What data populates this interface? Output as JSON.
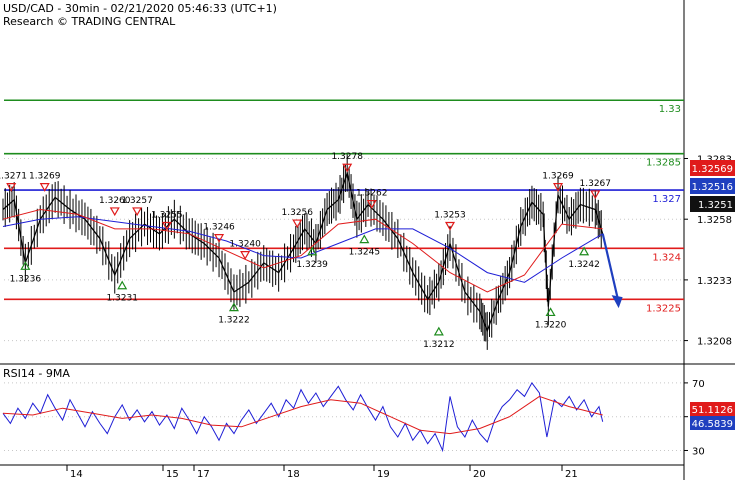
{
  "header": {
    "line1": "USD/CAD - 30min - 02/21/2020 05:46:33 (UTC+1)",
    "line2": "Research © TRADING CENTRAL"
  },
  "rsi_title": "RSI14 - 9MA",
  "chart_data": [
    {
      "type": "candlestick",
      "ylim": [
        1.32,
        1.3345
      ],
      "y_ticks": [
        "1.3283",
        "1.3258",
        "1.3233",
        "1.3208"
      ],
      "x_ticks": [
        "14",
        "15",
        "17",
        "18",
        "19",
        "20",
        "21"
      ],
      "levels": [
        {
          "label": "1.33",
          "value": 1.3307,
          "color": "#1e8c1e"
        },
        {
          "label": "1.3285",
          "value": 1.3285,
          "color": "#1e8c1e"
        },
        {
          "label": "1.327",
          "value": 1.327,
          "color": "#1f1fd6"
        },
        {
          "label": "1.324",
          "value": 1.3246,
          "color": "#e01b1b"
        },
        {
          "label": "1.3225",
          "value": 1.3225,
          "color": "#e01b1b"
        }
      ],
      "price_tags": [
        {
          "label": "1.32569",
          "value": 1.3257,
          "color": "#e01b1b"
        },
        {
          "label": "1.32516",
          "value": 1.3251,
          "color": "#1f3fbf"
        },
        {
          "label": "1.3251",
          "value": 1.3244,
          "color": "#111111"
        }
      ],
      "highs": [
        {
          "label": "1.3271",
          "x": 0.11,
          "value": 1.3271
        },
        {
          "label": "1.3269",
          "x": 0.56,
          "value": 1.3271
        },
        {
          "label": "1.3260",
          "x": 1.5,
          "value": 1.3261
        },
        {
          "label": "1.3257",
          "x": 1.8,
          "value": 1.3261
        },
        {
          "label": "1.3255",
          "x": 2.2,
          "value": 1.3255
        },
        {
          "label": "1.3246",
          "x": 2.9,
          "value": 1.325
        },
        {
          "label": "1.3240",
          "x": 3.25,
          "value": 1.3243
        },
        {
          "label": "1.3256",
          "x": 3.95,
          "value": 1.3256
        },
        {
          "label": "1.3278",
          "x": 4.62,
          "value": 1.3279
        },
        {
          "label": "1.3262",
          "x": 4.95,
          "value": 1.3264
        },
        {
          "label": "1.3253",
          "x": 6.0,
          "value": 1.3255
        },
        {
          "label": "1.3269",
          "x": 7.45,
          "value": 1.3271
        },
        {
          "label": "1.3267",
          "x": 7.95,
          "value": 1.3268
        }
      ],
      "lows": [
        {
          "label": "1.3236",
          "x": 0.3,
          "value": 1.3239
        },
        {
          "label": "1.3231",
          "x": 1.6,
          "value": 1.3231
        },
        {
          "label": "1.3222",
          "x": 3.1,
          "value": 1.3222
        },
        {
          "label": "1.3239",
          "x": 4.15,
          "value": 1.3245
        },
        {
          "label": "1.3245",
          "x": 4.85,
          "value": 1.325
        },
        {
          "label": "1.3212",
          "x": 5.85,
          "value": 1.3212
        },
        {
          "label": "1.3242",
          "x": 7.8,
          "value": 1.3245
        },
        {
          "label": "1.3220",
          "x": 7.35,
          "value": 1.322
        }
      ],
      "price_path": [
        [
          0,
          1.3262
        ],
        [
          0.15,
          1.3266
        ],
        [
          0.3,
          1.324
        ],
        [
          0.5,
          1.3258
        ],
        [
          0.7,
          1.3267
        ],
        [
          0.9,
          1.3262
        ],
        [
          1.1,
          1.3258
        ],
        [
          1.3,
          1.325
        ],
        [
          1.5,
          1.3235
        ],
        [
          1.7,
          1.325
        ],
        [
          1.9,
          1.3256
        ],
        [
          2.1,
          1.3252
        ],
        [
          2.3,
          1.3258
        ],
        [
          2.5,
          1.3252
        ],
        [
          2.7,
          1.3248
        ],
        [
          2.9,
          1.3242
        ],
        [
          3.1,
          1.3228
        ],
        [
          3.3,
          1.3232
        ],
        [
          3.5,
          1.324
        ],
        [
          3.7,
          1.3236
        ],
        [
          3.9,
          1.3246
        ],
        [
          4.05,
          1.3254
        ],
        [
          4.2,
          1.3248
        ],
        [
          4.35,
          1.3262
        ],
        [
          4.5,
          1.3266
        ],
        [
          4.62,
          1.3277
        ],
        [
          4.75,
          1.3258
        ],
        [
          4.9,
          1.3264
        ],
        [
          5.1,
          1.3258
        ],
        [
          5.3,
          1.325
        ],
        [
          5.5,
          1.3236
        ],
        [
          5.7,
          1.3225
        ],
        [
          5.85,
          1.3232
        ],
        [
          6.0,
          1.3248
        ],
        [
          6.2,
          1.3228
        ],
        [
          6.4,
          1.322
        ],
        [
          6.5,
          1.3212
        ],
        [
          6.65,
          1.3225
        ],
        [
          6.8,
          1.3236
        ],
        [
          6.95,
          1.3255
        ],
        [
          7.1,
          1.3265
        ],
        [
          7.25,
          1.326
        ],
        [
          7.32,
          1.3222
        ],
        [
          7.45,
          1.3268
        ],
        [
          7.6,
          1.3258
        ],
        [
          7.75,
          1.3264
        ],
        [
          7.95,
          1.3262
        ],
        [
          8.05,
          1.3252
        ]
      ],
      "ma_red": [
        [
          0,
          1.3258
        ],
        [
          0.5,
          1.3262
        ],
        [
          1.0,
          1.326
        ],
        [
          1.5,
          1.3254
        ],
        [
          2.0,
          1.3254
        ],
        [
          2.5,
          1.3252
        ],
        [
          3.0,
          1.3245
        ],
        [
          3.5,
          1.3238
        ],
        [
          4.0,
          1.3243
        ],
        [
          4.5,
          1.3256
        ],
        [
          5.0,
          1.3258
        ],
        [
          5.5,
          1.3248
        ],
        [
          6.0,
          1.3236
        ],
        [
          6.5,
          1.3228
        ],
        [
          7.0,
          1.3235
        ],
        [
          7.5,
          1.3256
        ],
        [
          8.05,
          1.3254
        ]
      ],
      "ma_blue": [
        [
          0,
          1.3255
        ],
        [
          0.5,
          1.3258
        ],
        [
          1.0,
          1.3259
        ],
        [
          1.5,
          1.3257
        ],
        [
          2.0,
          1.3255
        ],
        [
          2.5,
          1.3253
        ],
        [
          3.0,
          1.3249
        ],
        [
          3.5,
          1.3243
        ],
        [
          4.0,
          1.3242
        ],
        [
          4.5,
          1.3248
        ],
        [
          5.0,
          1.3254
        ],
        [
          5.5,
          1.3254
        ],
        [
          6.0,
          1.3246
        ],
        [
          6.5,
          1.3236
        ],
        [
          7.0,
          1.3232
        ],
        [
          7.5,
          1.3242
        ],
        [
          8.05,
          1.3252
        ]
      ],
      "forecast_arrow": [
        [
          8.05,
          1.3252
        ],
        [
          8.25,
          1.3223
        ]
      ]
    },
    {
      "type": "line",
      "title": "RSI14 - 9MA",
      "ylim": [
        22,
        80
      ],
      "y_ticks": [
        "70",
        "50",
        "30"
      ],
      "tags": [
        {
          "label": "51.1126",
          "value": 51.1,
          "color": "#e01b1b"
        },
        {
          "label": "46.5839",
          "value": 46.6,
          "color": "#1f3fbf"
        }
      ],
      "rsi": [
        [
          0,
          52
        ],
        [
          0.1,
          46
        ],
        [
          0.2,
          55
        ],
        [
          0.3,
          49
        ],
        [
          0.4,
          58
        ],
        [
          0.5,
          52
        ],
        [
          0.6,
          63
        ],
        [
          0.7,
          55
        ],
        [
          0.8,
          48
        ],
        [
          0.9,
          60
        ],
        [
          1.0,
          52
        ],
        [
          1.1,
          44
        ],
        [
          1.2,
          53
        ],
        [
          1.3,
          46
        ],
        [
          1.4,
          40
        ],
        [
          1.5,
          50
        ],
        [
          1.6,
          57
        ],
        [
          1.7,
          48
        ],
        [
          1.8,
          54
        ],
        [
          1.9,
          47
        ],
        [
          2.0,
          53
        ],
        [
          2.1,
          45
        ],
        [
          2.2,
          51
        ],
        [
          2.3,
          43
        ],
        [
          2.4,
          55
        ],
        [
          2.5,
          48
        ],
        [
          2.6,
          40
        ],
        [
          2.7,
          50
        ],
        [
          2.8,
          44
        ],
        [
          2.9,
          36
        ],
        [
          3.0,
          46
        ],
        [
          3.1,
          40
        ],
        [
          3.2,
          48
        ],
        [
          3.3,
          54
        ],
        [
          3.4,
          46
        ],
        [
          3.5,
          52
        ],
        [
          3.6,
          58
        ],
        [
          3.7,
          50
        ],
        [
          3.8,
          60
        ],
        [
          3.9,
          55
        ],
        [
          4.0,
          66
        ],
        [
          4.1,
          58
        ],
        [
          4.2,
          64
        ],
        [
          4.3,
          56
        ],
        [
          4.4,
          62
        ],
        [
          4.5,
          68
        ],
        [
          4.6,
          60
        ],
        [
          4.7,
          54
        ],
        [
          4.8,
          63
        ],
        [
          4.9,
          55
        ],
        [
          5.0,
          48
        ],
        [
          5.1,
          56
        ],
        [
          5.2,
          44
        ],
        [
          5.3,
          38
        ],
        [
          5.4,
          46
        ],
        [
          5.5,
          36
        ],
        [
          5.6,
          42
        ],
        [
          5.7,
          34
        ],
        [
          5.8,
          40
        ],
        [
          5.9,
          30
        ],
        [
          6.0,
          62
        ],
        [
          6.1,
          44
        ],
        [
          6.2,
          38
        ],
        [
          6.3,
          48
        ],
        [
          6.4,
          40
        ],
        [
          6.5,
          35
        ],
        [
          6.6,
          48
        ],
        [
          6.7,
          56
        ],
        [
          6.8,
          60
        ],
        [
          6.9,
          66
        ],
        [
          7.0,
          62
        ],
        [
          7.1,
          70
        ],
        [
          7.2,
          64
        ],
        [
          7.3,
          38
        ],
        [
          7.4,
          60
        ],
        [
          7.5,
          56
        ],
        [
          7.6,
          62
        ],
        [
          7.7,
          54
        ],
        [
          7.8,
          60
        ],
        [
          7.9,
          50
        ],
        [
          8.0,
          56
        ],
        [
          8.05,
          47
        ]
      ],
      "ma": [
        [
          0,
          52
        ],
        [
          0.4,
          51
        ],
        [
          0.8,
          55
        ],
        [
          1.2,
          52
        ],
        [
          1.6,
          49
        ],
        [
          2.0,
          51
        ],
        [
          2.4,
          49
        ],
        [
          2.8,
          45
        ],
        [
          3.2,
          44
        ],
        [
          3.6,
          50
        ],
        [
          4.0,
          56
        ],
        [
          4.4,
          60
        ],
        [
          4.8,
          58
        ],
        [
          5.2,
          50
        ],
        [
          5.6,
          42
        ],
        [
          6.0,
          40
        ],
        [
          6.4,
          43
        ],
        [
          6.8,
          50
        ],
        [
          7.2,
          62
        ],
        [
          7.6,
          56
        ],
        [
          8.05,
          51
        ]
      ]
    }
  ]
}
